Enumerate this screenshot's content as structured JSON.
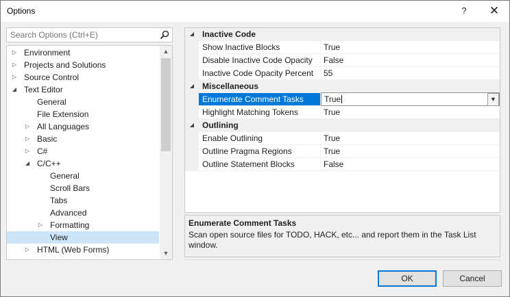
{
  "window": {
    "title": "Options",
    "help_label": "?",
    "close_label": "✕"
  },
  "search": {
    "placeholder": "Search Options (Ctrl+E)"
  },
  "tree": {
    "items": [
      {
        "label": "Environment",
        "level": 0,
        "expander": "collapsed"
      },
      {
        "label": "Projects and Solutions",
        "level": 0,
        "expander": "collapsed"
      },
      {
        "label": "Source Control",
        "level": 0,
        "expander": "collapsed"
      },
      {
        "label": "Text Editor",
        "level": 0,
        "expander": "expanded"
      },
      {
        "label": "General",
        "level": 1,
        "expander": "none"
      },
      {
        "label": "File Extension",
        "level": 1,
        "expander": "none"
      },
      {
        "label": "All Languages",
        "level": 1,
        "expander": "collapsed"
      },
      {
        "label": "Basic",
        "level": 1,
        "expander": "collapsed"
      },
      {
        "label": "C#",
        "level": 1,
        "expander": "collapsed"
      },
      {
        "label": "C/C++",
        "level": 1,
        "expander": "expanded"
      },
      {
        "label": "General",
        "level": 2,
        "expander": "none"
      },
      {
        "label": "Scroll Bars",
        "level": 2,
        "expander": "none"
      },
      {
        "label": "Tabs",
        "level": 2,
        "expander": "none"
      },
      {
        "label": "Advanced",
        "level": 2,
        "expander": "none"
      },
      {
        "label": "Formatting",
        "level": 2,
        "expander": "collapsed"
      },
      {
        "label": "View",
        "level": 2,
        "expander": "none",
        "selected": true
      },
      {
        "label": "HTML (Web Forms)",
        "level": 1,
        "expander": "collapsed"
      }
    ]
  },
  "grid": {
    "rows": [
      {
        "type": "category",
        "label": "Inactive Code"
      },
      {
        "type": "prop",
        "name": "Show Inactive Blocks",
        "value": "True"
      },
      {
        "type": "prop",
        "name": "Disable Inactive Code Opacity",
        "value": "False"
      },
      {
        "type": "prop",
        "name": "Inactive Code Opacity Percent",
        "value": "55"
      },
      {
        "type": "category",
        "label": "Miscellaneous"
      },
      {
        "type": "prop",
        "name": "Enumerate Comment Tasks",
        "value": "True",
        "selected": true
      },
      {
        "type": "prop",
        "name": "Highlight Matching Tokens",
        "value": "True"
      },
      {
        "type": "category",
        "label": "Outlining"
      },
      {
        "type": "prop",
        "name": "Enable Outlining",
        "value": "True"
      },
      {
        "type": "prop",
        "name": "Outline Pragma Regions",
        "value": "True"
      },
      {
        "type": "prop",
        "name": "Outline Statement Blocks",
        "value": "False"
      }
    ]
  },
  "description": {
    "title": "Enumerate Comment Tasks",
    "text": "Scan open source files for TODO, HACK, etc... and report them in the Task List window."
  },
  "buttons": {
    "ok": "OK",
    "cancel": "Cancel"
  },
  "colors": {
    "accent": "#0078d7",
    "tree_selection": "#cce4f7",
    "background": "#f0f0f0"
  }
}
